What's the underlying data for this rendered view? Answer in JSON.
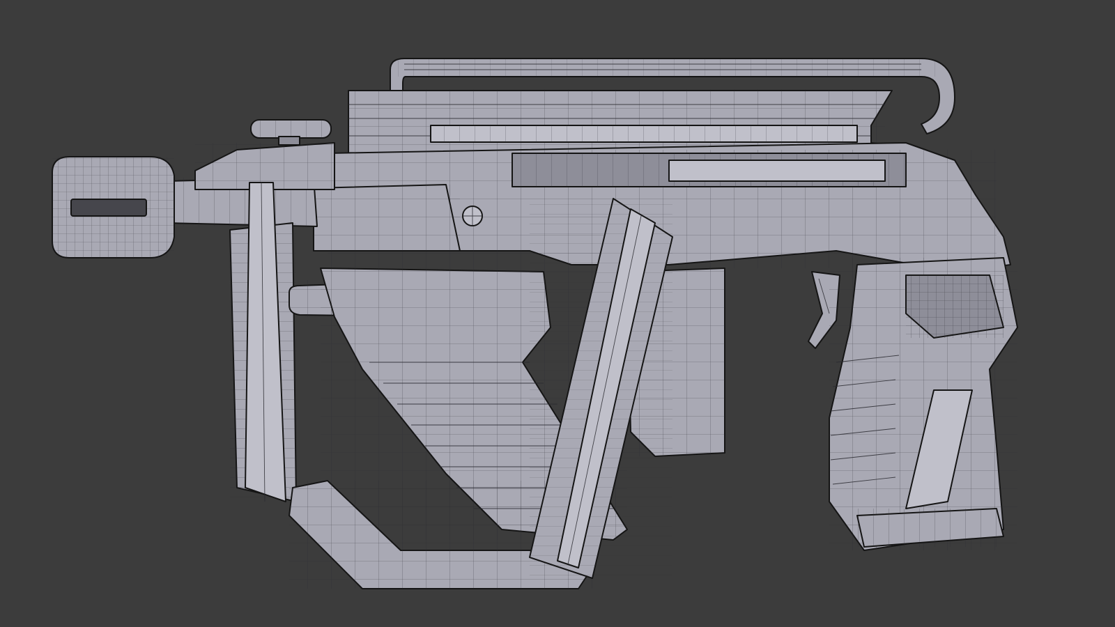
{
  "scene": {
    "background_color": "#3c3c3c",
    "mesh_color": "#a9a9b4",
    "wire_color": "#151515",
    "subject": "wireframe-weapon-model"
  }
}
